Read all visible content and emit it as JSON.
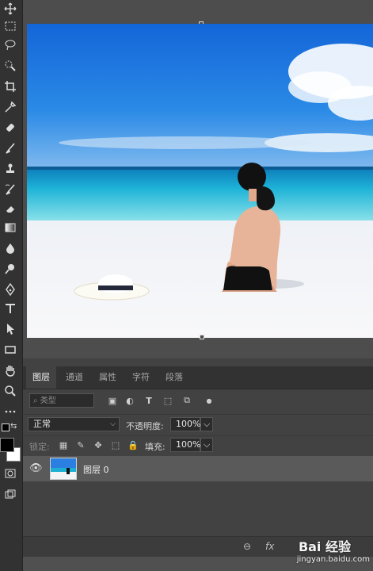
{
  "layers_panel": {
    "tabs": [
      "图层",
      "通道",
      "属性",
      "字符",
      "段落"
    ],
    "filter_placeholder": "类型",
    "blend_mode": "正常",
    "opacity_label": "不透明度:",
    "opacity_value": "100%",
    "lock_label": "锁定:",
    "fill_label": "填充:",
    "fill_value": "100%",
    "layers": [
      {
        "name": "图层 0"
      }
    ],
    "footer_icons": [
      "link-icon",
      "fx-icon"
    ]
  },
  "watermark": {
    "text": "Bai 经验",
    "url": "jingyan.baidu.com"
  },
  "tools": [
    "move-tool-icon",
    "marquee-tool-icon",
    "lasso-tool-icon",
    "quick-select-icon",
    "crop-tool-icon",
    "eyedropper-icon",
    "healing-brush-icon",
    "brush-tool-icon",
    "clone-stamp-icon",
    "history-brush-icon",
    "eraser-icon",
    "gradient-icon",
    "blur-icon",
    "dodge-icon",
    "pen-tool-icon",
    "type-tool-icon",
    "path-select-icon",
    "rectangle-tool-icon",
    "hand-tool-icon",
    "zoom-tool-icon",
    "more-tools-icon"
  ],
  "colors": {
    "foreground": "#000000",
    "background": "#ffffff",
    "ui_dark": "#323232",
    "panel": "#424242"
  }
}
